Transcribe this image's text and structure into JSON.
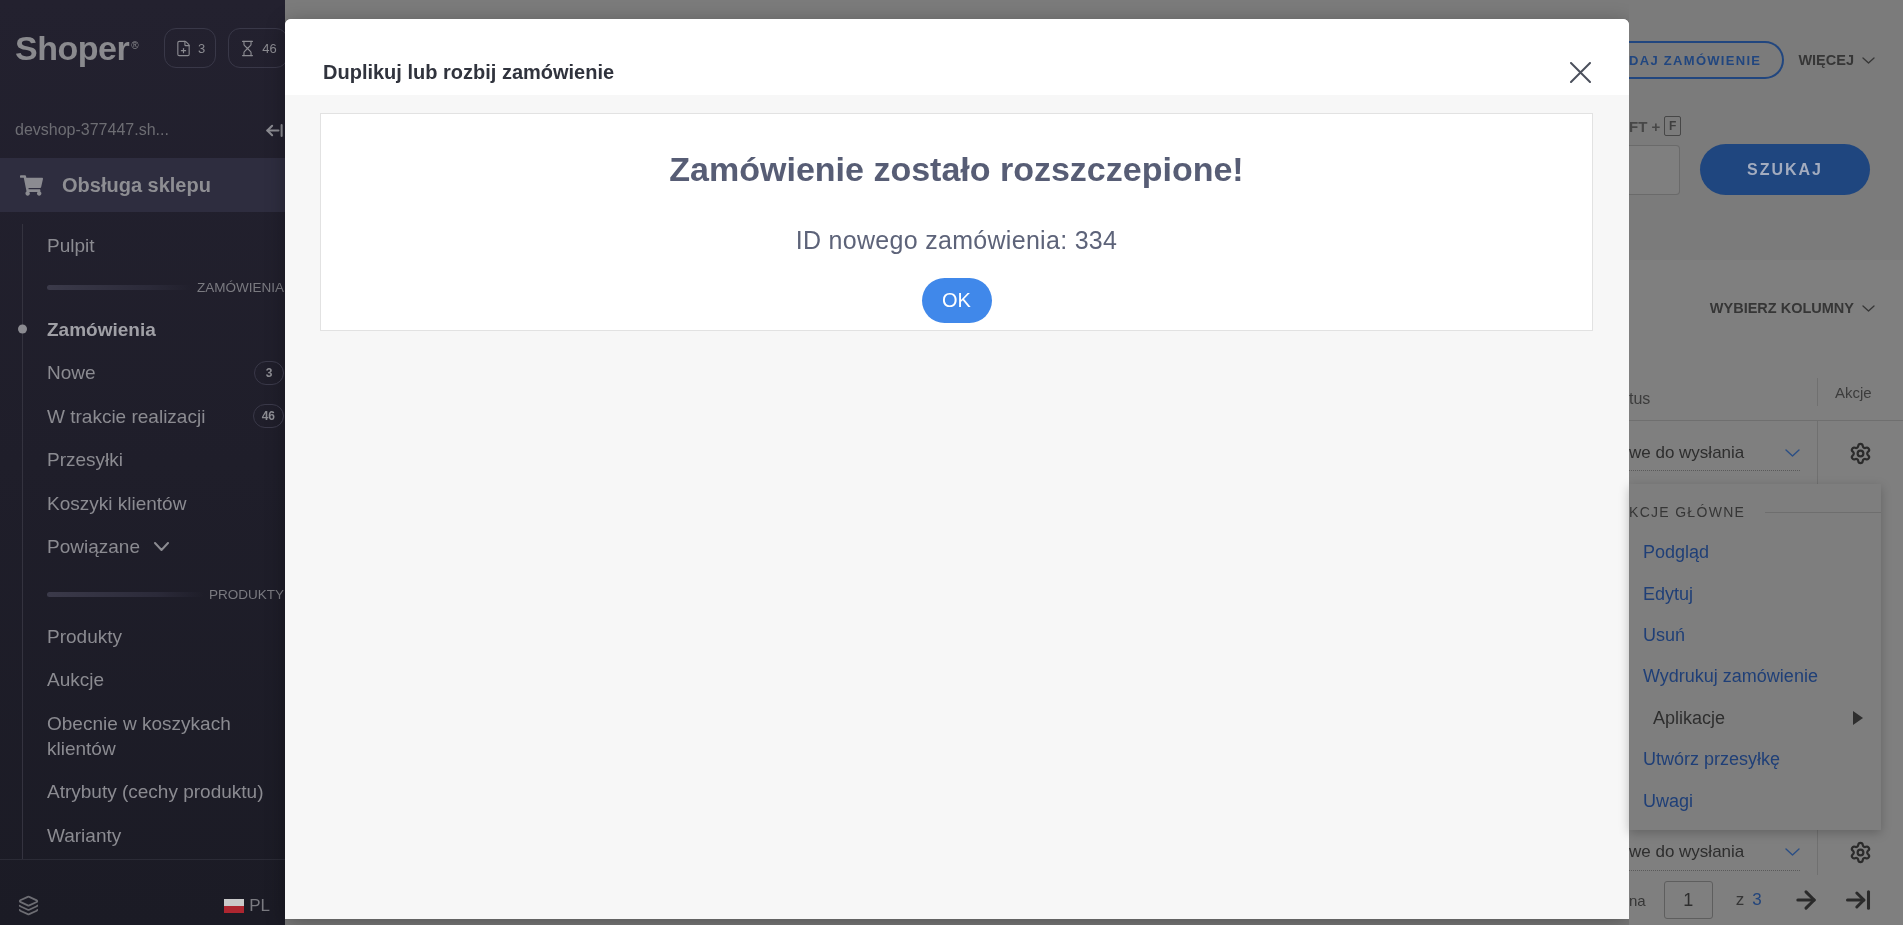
{
  "sidebar": {
    "logo": "Shoper$^{®}$",
    "counters": [
      {
        "count": "3"
      },
      {
        "count": "46"
      }
    ],
    "shop_name": "devshop-377447.sh...",
    "section": {
      "label": "Obsługa sklepu",
      "selected": true
    },
    "nav": [
      {
        "kind": "item",
        "label": "Pulpit",
        "selected": false
      },
      {
        "kind": "divider",
        "label": "ZAMÓWIENIA"
      },
      {
        "kind": "item",
        "label": "Zamówienia",
        "selected": true
      },
      {
        "kind": "item",
        "label": "Nowe",
        "badge": "3",
        "selected": false
      },
      {
        "kind": "item",
        "label": "W trakcie realizacji",
        "badge": "46",
        "selected": false
      },
      {
        "kind": "item",
        "label": "Przesyłki",
        "selected": false
      },
      {
        "kind": "item",
        "label": "Koszyki klientów",
        "selected": false
      },
      {
        "kind": "group",
        "label": "Powiązane",
        "expanded": false,
        "selected": false
      },
      {
        "kind": "divider",
        "label": "PRODUKTY"
      },
      {
        "kind": "item",
        "label": "Produkty",
        "selected": false
      },
      {
        "kind": "item",
        "label": "Aukcje",
        "selected": false
      },
      {
        "kind": "item",
        "label": "Obecnie w koszykach klientów",
        "selected": false
      },
      {
        "kind": "item",
        "label": "Atrybuty (cechy produktu)",
        "selected": false
      },
      {
        "kind": "item",
        "label": "Warianty",
        "selected": false
      }
    ],
    "language": "PL"
  },
  "dialog": {
    "title": "Duplikuj lub rozbij zamówienie",
    "heading": "Zamówienie zostało rozszczepione!",
    "message": "ID nowego zamówienia: 334",
    "button": "OK"
  },
  "page": {
    "header_buttons": [
      {
        "kind": "outline",
        "label": "DAJ ZAMÓWIENIE"
      },
      {
        "kind": "menu",
        "label": "WIĘCEJ"
      }
    ],
    "search": {
      "shortcut_prefix": "FT +",
      "shortcut_key": "F",
      "button": "SZUKAJ"
    },
    "columns_button": "WYBIERZ KOLUMNY",
    "table": {
      "columns": [
        "tus",
        "Akcje"
      ],
      "rows": [
        {
          "status": "we do wysłania"
        },
        {
          "status": "we do wysłania"
        }
      ]
    },
    "actions_menu": {
      "heading": "KCJE GŁÓWNE",
      "items": [
        {
          "kind": "link",
          "label": "Podgląd"
        },
        {
          "kind": "link",
          "label": "Edytuj"
        },
        {
          "kind": "link",
          "label": "Usuń"
        },
        {
          "kind": "link",
          "label": "Wydrukuj zamówienie"
        },
        {
          "kind": "submenu",
          "label": "Aplikacje"
        },
        {
          "kind": "link",
          "label": "Utwórz przesyłkę"
        },
        {
          "kind": "link",
          "label": "Uwagi"
        }
      ]
    },
    "pagination": {
      "prefix": "na",
      "page": "1",
      "separator": "z",
      "total": "3"
    }
  }
}
